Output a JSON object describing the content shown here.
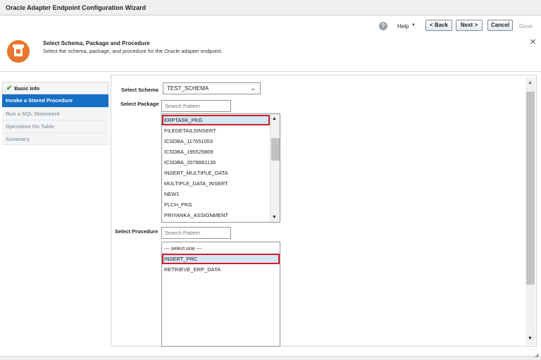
{
  "window": {
    "title": "Oracle Adapter Endpoint Configuration Wizard"
  },
  "toolbar": {
    "help_label": "Help",
    "back_label": "< Back",
    "next_label": "Next >",
    "cancel_label": "Cancel",
    "done_label": "Done"
  },
  "header": {
    "title": "Select Schema, Package and Procedure",
    "subtitle": "Select the schema, package, and procedure for the Oracle adapter endpoint."
  },
  "sidebar": {
    "items": [
      {
        "label": "Basic Info",
        "state": "completed"
      },
      {
        "label": "Invoke a Stored Procedure",
        "state": "active"
      },
      {
        "label": "Run a SQL Statement",
        "state": "disabled"
      },
      {
        "label": "Operation On Table",
        "state": "disabled"
      },
      {
        "label": "Summary",
        "state": "disabled"
      }
    ]
  },
  "form": {
    "schema_label": "Select Schema",
    "schema_value": "TEST_SCHEMA",
    "package_label": "Select Package",
    "package_search_placeholder": "Search Pattern",
    "packages": [
      "ERPTASK_PKG",
      "FILEDETAILSINSERT",
      "ICSDBA_117651053",
      "ICSDBA_195525809",
      "ICSDBA_2078881136",
      "INSERT_MULTIPLE_DATA",
      "MULTIPLE_DATA_INSERT",
      "NEW1",
      "PLCH_PKG",
      "PRIYANKA_ASSIGNMENT"
    ],
    "selected_package": "ERPTASK_PKG",
    "procedure_label": "Select Procedure",
    "procedure_search_placeholder": "Search Pattern",
    "procedures": [
      "--- select one ---",
      "INSERT_PRC",
      "RETRIEVE_ERP_DATA"
    ],
    "selected_procedure": "INSERT_PRC"
  },
  "colors": {
    "accent": "#1570c5",
    "selection_outline": "#d0202a",
    "header_icon": "#e8762d",
    "check": "#3c9a2f"
  },
  "icons": {
    "help": "help-circle-icon",
    "close": "close-icon",
    "check": "check-icon",
    "dropdown": "chevron-down-icon"
  }
}
